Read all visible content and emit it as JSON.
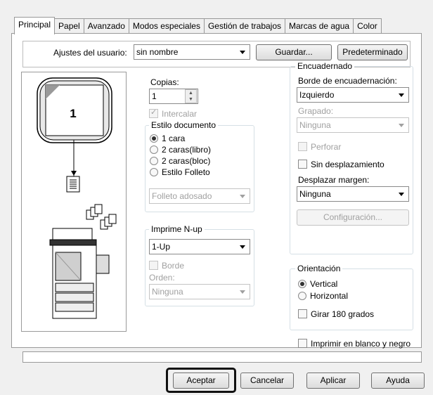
{
  "tabs": [
    "Principal",
    "Papel",
    "Avanzado",
    "Modos especiales",
    "Gestión de trabajos",
    "Marcas de agua",
    "Color"
  ],
  "user_settings": {
    "label": "Ajustes del usuario:",
    "value": "sin nombre",
    "save_label": "Guardar...",
    "default_label": "Predeterminado"
  },
  "preview": {
    "page_number": "1"
  },
  "copies": {
    "label": "Copias:",
    "value": "1",
    "collate_label": "Intercalar"
  },
  "document_style": {
    "title": "Estilo documento",
    "options": [
      "1 cara",
      "2 caras(libro)",
      "2 caras(bloc)",
      "Estilo Folleto"
    ],
    "selected": 0,
    "booklet_value": "Folleto adosado"
  },
  "nup": {
    "title": "Imprime N-up",
    "value": "1-Up",
    "border_label": "Borde",
    "order_label": "Orden:",
    "order_value": "Ninguna"
  },
  "binding": {
    "title": "Encuadernado",
    "edge_label": "Borde de encuadernación:",
    "edge_value": "Izquierdo",
    "staple_label": "Grapado:",
    "staple_value": "Ninguna",
    "punch_label": "Perforar",
    "no_offset_label": "Sin desplazamiento",
    "margin_label": "Desplazar margen:",
    "margin_value": "Ninguna",
    "config_label": "Configuración..."
  },
  "orientation": {
    "title": "Orientación",
    "options": [
      "Vertical",
      "Horizontal"
    ],
    "selected": 0,
    "rotate_label": "Girar 180 grados"
  },
  "bw_label": "Imprimir en blanco y negro",
  "buttons": {
    "ok": "Aceptar",
    "cancel": "Cancelar",
    "apply": "Aplicar",
    "help": "Ayuda"
  }
}
